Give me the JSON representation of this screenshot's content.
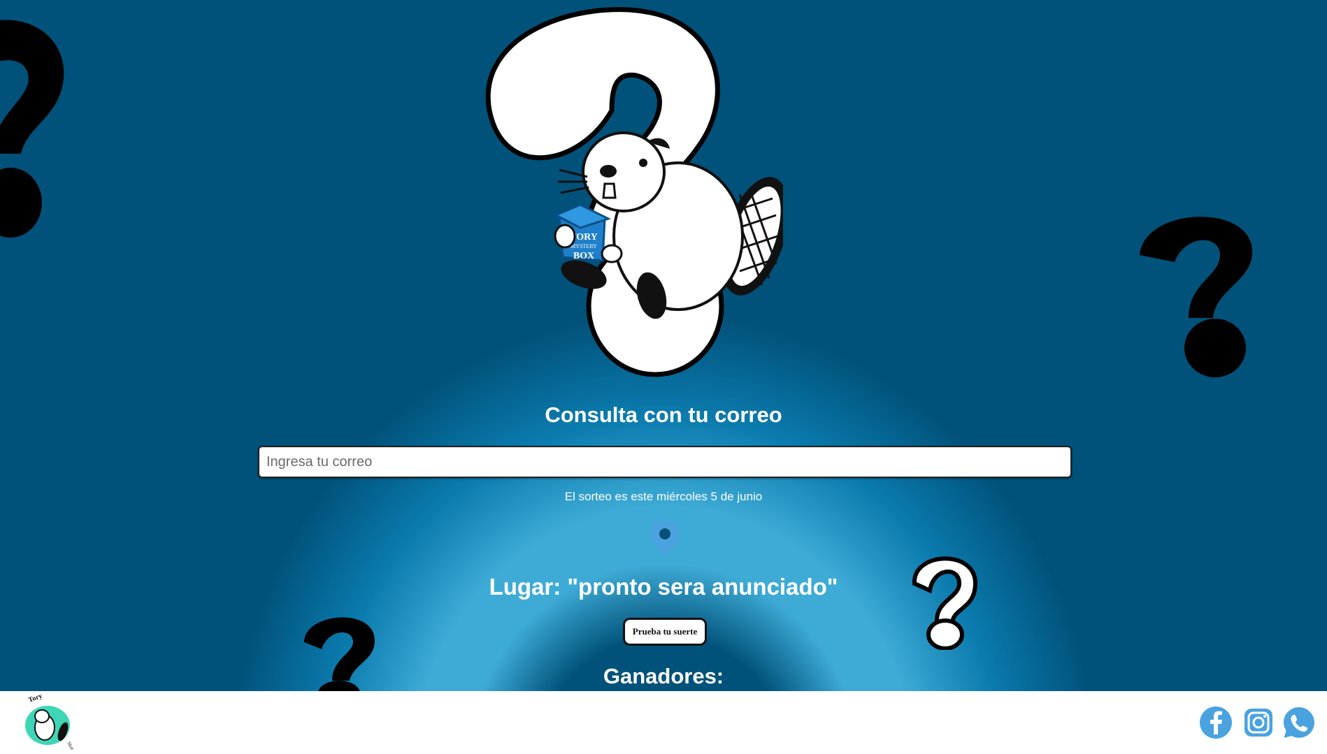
{
  "main": {
    "title": "Consulta con tu correo",
    "email_placeholder": "Ingresa tu correo",
    "email_value": "",
    "draw_date": "El sorteo es este miércoles 5 de junio",
    "place": "Lugar: \"pronto sera anunciado\"",
    "luck_button": "Prueba tu suerte",
    "winners_heading": "Ganadores:"
  },
  "hero": {
    "box_label_top": "TORY",
    "box_label_mid": "MYSTERY",
    "box_label_bottom": "BOX"
  },
  "footer": {
    "logo_text_top": "Tory",
    "logo_text_side": "Skate",
    "social": [
      "facebook",
      "instagram",
      "whatsapp"
    ]
  },
  "colors": {
    "background_dark": "#01527a",
    "background_glow": "#3eabd6",
    "accent_blue": "#4aa3df",
    "box_blue": "#1f7fc9",
    "footer_bg": "#ffffff"
  },
  "icons": [
    "question-mark-icon",
    "beaver-mascot",
    "location-pin-icon",
    "facebook-icon",
    "instagram-icon",
    "whatsapp-icon"
  ]
}
